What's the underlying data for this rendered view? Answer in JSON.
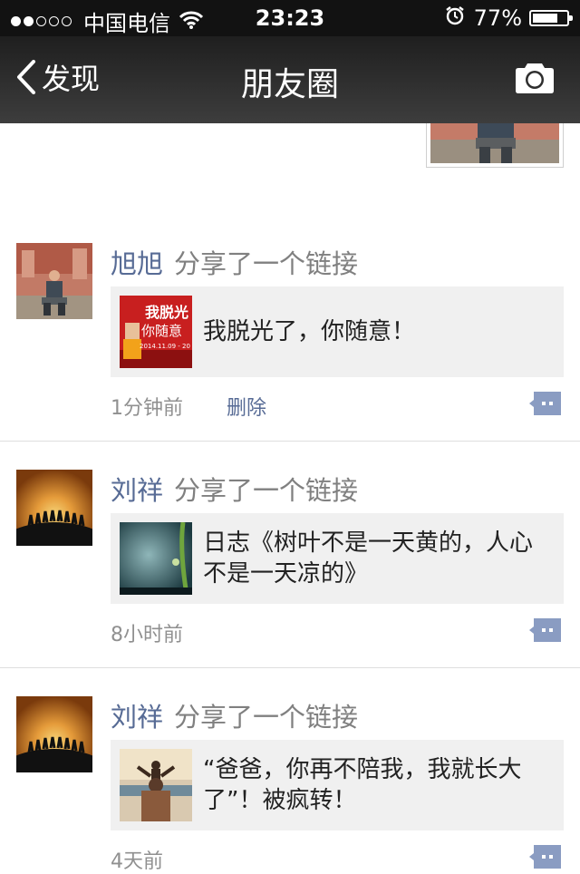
{
  "status_bar": {
    "signal_filled": 2,
    "signal_total": 5,
    "carrier": "中国电信",
    "time": "23:23",
    "battery_percent": "77%",
    "battery_level": 0.77,
    "icons": [
      "wifi-icon",
      "alarm-icon",
      "battery-icon"
    ]
  },
  "nav": {
    "back_label": "发现",
    "title": "朋友圈",
    "camera_icon": "camera-icon"
  },
  "colors": {
    "link_blue": "#576b95",
    "nav_dark": "#2b2b2b",
    "card_bg": "#f0f0f0"
  },
  "feed": [
    {
      "name": "旭旭",
      "action": "分享了一个链接",
      "link_text": "我脱光了，你随意！",
      "thumb_text": [
        "我脱光",
        "你随意",
        "2014.11.09 - 20"
      ],
      "time": "1分钟前",
      "delete_label": "删除"
    },
    {
      "name": "刘祥",
      "action": "分享了一个链接",
      "link_text": "日志《树叶不是一天黄的，人心不是一天凉的》",
      "time": "8小时前"
    },
    {
      "name": "刘祥",
      "action": "分享了一个链接",
      "link_text": "“爸爸，你再不陪我，我就长大了”！被疯转！",
      "time": "4天前"
    }
  ]
}
